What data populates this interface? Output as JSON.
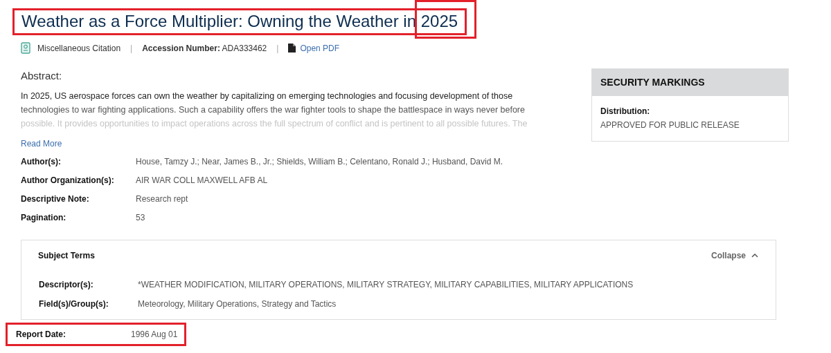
{
  "title": {
    "text": "Weather as a Force Multiplier: Owning the Weather in",
    "year": "2025",
    "highlighted": true,
    "year_highlighted": true
  },
  "meta": [
    {
      "kind": "citation",
      "text": "Miscellaneous Citation"
    },
    {
      "kind": "separator",
      "text": "|"
    },
    {
      "kind": "accession",
      "label": "Accession Number:",
      "text": "ADA333462"
    },
    {
      "kind": "separator",
      "text": "|"
    },
    {
      "kind": "pdf",
      "text": "Open PDF"
    }
  ],
  "abstract": {
    "heading": "Abstract:",
    "lines": [
      "In 2025, US aerospace forces can own the weather by capitalizing on emerging technologies and focusing development of those",
      "technologies to war fighting applications. Such a capability offers the war fighter tools to shape the battlespace in ways never before",
      "possible. It provides opportunities to impact operations across the full spectrum of conflict and is pertinent to all possible futures. The"
    ],
    "read_more": "Read More"
  },
  "details": [
    {
      "label": "Author(s):",
      "value": "House, Tamzy J.; Near, James B., Jr.; Shields, William B.; Celentano, Ronald J.; Husband, David M."
    },
    {
      "label": "Author Organization(s):",
      "value": "AIR WAR COLL MAXWELL AFB AL"
    },
    {
      "label": "Descriptive Note:",
      "value": "Research rept"
    },
    {
      "label": "Pagination:",
      "value": "53"
    }
  ],
  "subject_terms": {
    "heading": "Subject Terms",
    "toggle": "Collapse",
    "expanded": true,
    "rows": [
      {
        "label": "Descriptor(s):",
        "value": "*WEATHER MODIFICATION, MILITARY OPERATIONS, MILITARY STRATEGY, MILITARY CAPABILITIES, MILITARY APPLICATIONS"
      },
      {
        "label": "Field(s)/Group(s):",
        "value": "Meteorology, Military Operations, Strategy and Tactics"
      }
    ]
  },
  "report_date": {
    "label": "Report Date:",
    "value": "1996 Aug 01",
    "highlighted": true
  },
  "security": {
    "heading": "SECURITY MARKINGS",
    "label": "Distribution:",
    "value": "APPROVED FOR PUBLIC RELEASE"
  }
}
